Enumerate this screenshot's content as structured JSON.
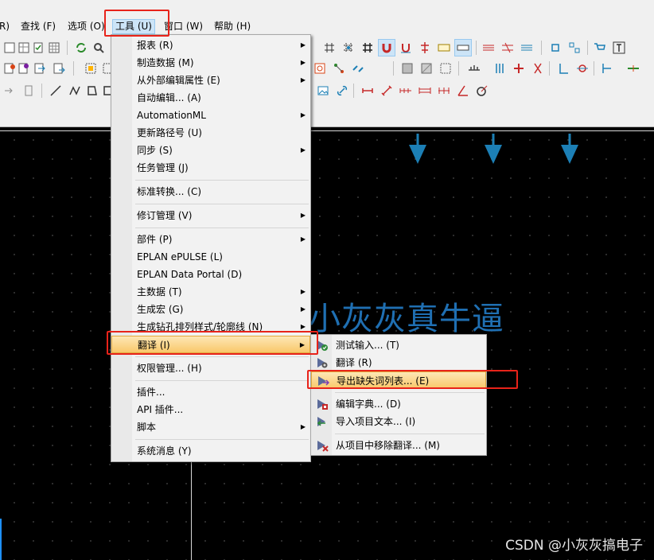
{
  "menubar": {
    "items": [
      {
        "label": "R)"
      },
      {
        "label": "查找 (F)"
      },
      {
        "label": "选项 (O)"
      },
      {
        "label": "工具 (U)"
      },
      {
        "label": "窗口 (W)"
      },
      {
        "label": "帮助 (H)"
      }
    ]
  },
  "tools_menu": {
    "items": [
      {
        "label": "报表 (R)",
        "submenu": true
      },
      {
        "label": "制造数据 (M)",
        "submenu": true
      },
      {
        "label": "从外部编辑属性 (E)",
        "submenu": true
      },
      {
        "label": "自动编辑... (A)",
        "submenu": false
      },
      {
        "label": "AutomationML",
        "submenu": true
      },
      {
        "label": "更新路径号 (U)",
        "submenu": false
      },
      {
        "label": "同步 (S)",
        "submenu": true
      },
      {
        "label": "任务管理 (J)",
        "submenu": false
      },
      {
        "label": "标准转换... (C)",
        "submenu": false
      },
      {
        "label": "修订管理 (V)",
        "submenu": true
      },
      {
        "label": "部件 (P)",
        "submenu": true
      },
      {
        "label": "EPLAN ePULSE (L)",
        "submenu": false
      },
      {
        "label": "EPLAN Data Portal (D)",
        "submenu": false
      },
      {
        "label": "主数据 (T)",
        "submenu": true
      },
      {
        "label": "生成宏 (G)",
        "submenu": true
      },
      {
        "label": "生成钻孔排列样式/轮廓线 (N)",
        "submenu": true
      },
      {
        "label": "翻译 (I)",
        "submenu": true
      },
      {
        "label": "权限管理... (H)",
        "submenu": false
      },
      {
        "label": "插件...",
        "submenu": false
      },
      {
        "label": "API 插件...",
        "submenu": false
      },
      {
        "label": "脚本",
        "submenu": true
      },
      {
        "label": "系统消息 (Y)",
        "submenu": false
      }
    ]
  },
  "translate_submenu": {
    "items": [
      {
        "label": "测试输入... (T)",
        "icon": "test-input-icon"
      },
      {
        "label": "翻译 (R)",
        "icon": "translate-icon"
      },
      {
        "label": "导出缺失词列表... (E)",
        "icon": "export-missing-words-icon"
      },
      {
        "label": "编辑字典... (D)",
        "icon": "edit-dictionary-icon"
      },
      {
        "label": "导入项目文本... (I)",
        "icon": "import-project-text-icon"
      },
      {
        "label": "从项目中移除翻译... (M)",
        "icon": "remove-translation-icon"
      }
    ]
  },
  "canvas": {
    "watermark": "小灰灰真牛逼",
    "csdn_credit": "CSDN @小灰灰搞电子"
  },
  "colors": {
    "highlight_top": "#fde7b5",
    "highlight_bottom": "#f9c86a",
    "callout_red": "#e8231a",
    "arrow_blue": "#1c7fb5",
    "watermark_blue": "#1f6fb2"
  }
}
